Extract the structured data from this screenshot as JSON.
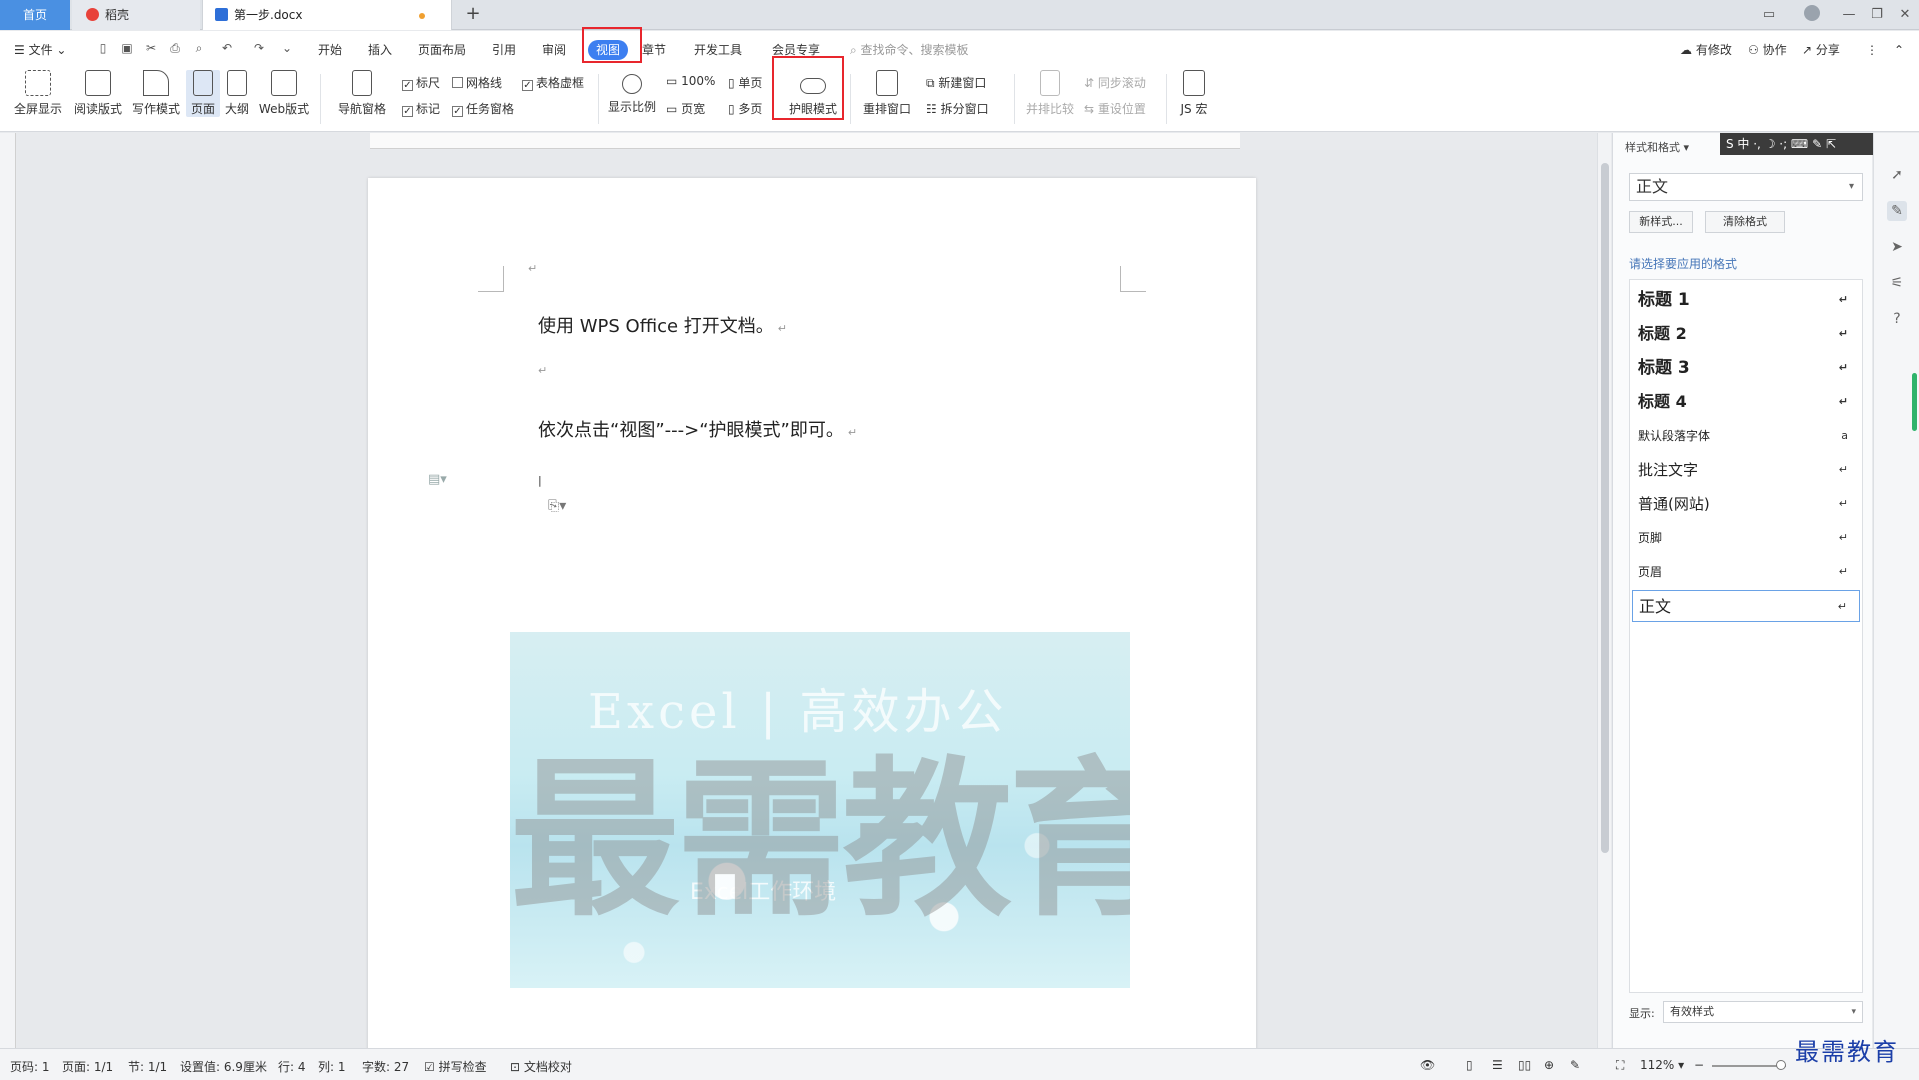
{
  "tabs": {
    "home": "首页",
    "daoke": "稻壳",
    "doc": "第一步.docx",
    "add": "+"
  },
  "window": {
    "minimize": "—",
    "restore": "❐",
    "close": "✕"
  },
  "menu": {
    "file": "文件",
    "items": [
      "开始",
      "插入",
      "页面布局",
      "引用",
      "审阅",
      "视图",
      "章节",
      "开发工具",
      "会员专享"
    ],
    "search_placeholder": "查找命令、搜索模板",
    "modified": "有修改",
    "collab": "协作",
    "share": "分享"
  },
  "ribbon": {
    "fullscreen": "全屏显示",
    "reading": "阅读版式",
    "writing": "写作模式",
    "page": "页面",
    "outline": "大纲",
    "web": "Web版式",
    "nav_pane": "导航窗格",
    "ruler": "标尺",
    "gridlines": "网格线",
    "table_gridlines": "表格虚框",
    "marks": "标记",
    "task_pane": "任务窗格",
    "zoom": "显示比例",
    "zoom100": "100%",
    "page_width": "页宽",
    "single_page": "单页",
    "multi_page": "多页",
    "eye_mode": "护眼模式",
    "arrange": "重排窗口",
    "new_window": "新建窗口",
    "split_window": "拆分窗口",
    "side_by_side": "并排比较",
    "sync_scroll": "同步滚动",
    "reset_pos": "重设位置",
    "js_macro": "JS 宏"
  },
  "document": {
    "para1": "使用 WPS Office 打开文档。",
    "para2": "依次点击“视图”--->“护眼模式”即可。",
    "return_mark": "↵",
    "image_title": "Excel | 高效办公",
    "image_subtitle": "Excel工作环境",
    "watermark": "最需教育"
  },
  "pane": {
    "title": "样式和格式",
    "current_style": "正文",
    "new_style": "新样式...",
    "clear_format": "清除格式",
    "choose_label": "请选择要应用的格式",
    "styles": [
      {
        "name": "标题  1",
        "bold": true,
        "size": 17
      },
      {
        "name": "标题  2",
        "bold": true,
        "size": 16
      },
      {
        "name": "标题  3",
        "bold": true,
        "size": 17
      },
      {
        "name": "标题  4",
        "bold": true,
        "size": 16
      },
      {
        "name": "默认段落字体",
        "bold": false,
        "size": 12
      },
      {
        "name": "批注文字",
        "bold": false,
        "size": 15
      },
      {
        "name": "普通(网站)",
        "bold": false,
        "size": 15
      },
      {
        "name": "页脚",
        "bold": false,
        "size": 12
      },
      {
        "name": "页眉",
        "bold": false,
        "size": 12
      },
      {
        "name": "正文",
        "bold": false,
        "size": 16
      }
    ],
    "show_label": "显示:",
    "show_value": "有效样式"
  },
  "ime": "S 中 ·, ☽ ·; ⌨ ✎ ⇱",
  "status": {
    "page": "页码: 1",
    "pages": "页面: 1/1",
    "section": "节: 1/1",
    "setting": "设置值: 6.9厘米",
    "row": "行: 4",
    "col": "列: 1",
    "words": "字数: 27",
    "spell": "拼写检查",
    "proof": "文档校对",
    "zoom": "112%"
  },
  "brand": "最需教育",
  "colors": {
    "accent": "#3d7ff0",
    "highlight": "#e8262d",
    "home_tab": "#4a90e2"
  }
}
